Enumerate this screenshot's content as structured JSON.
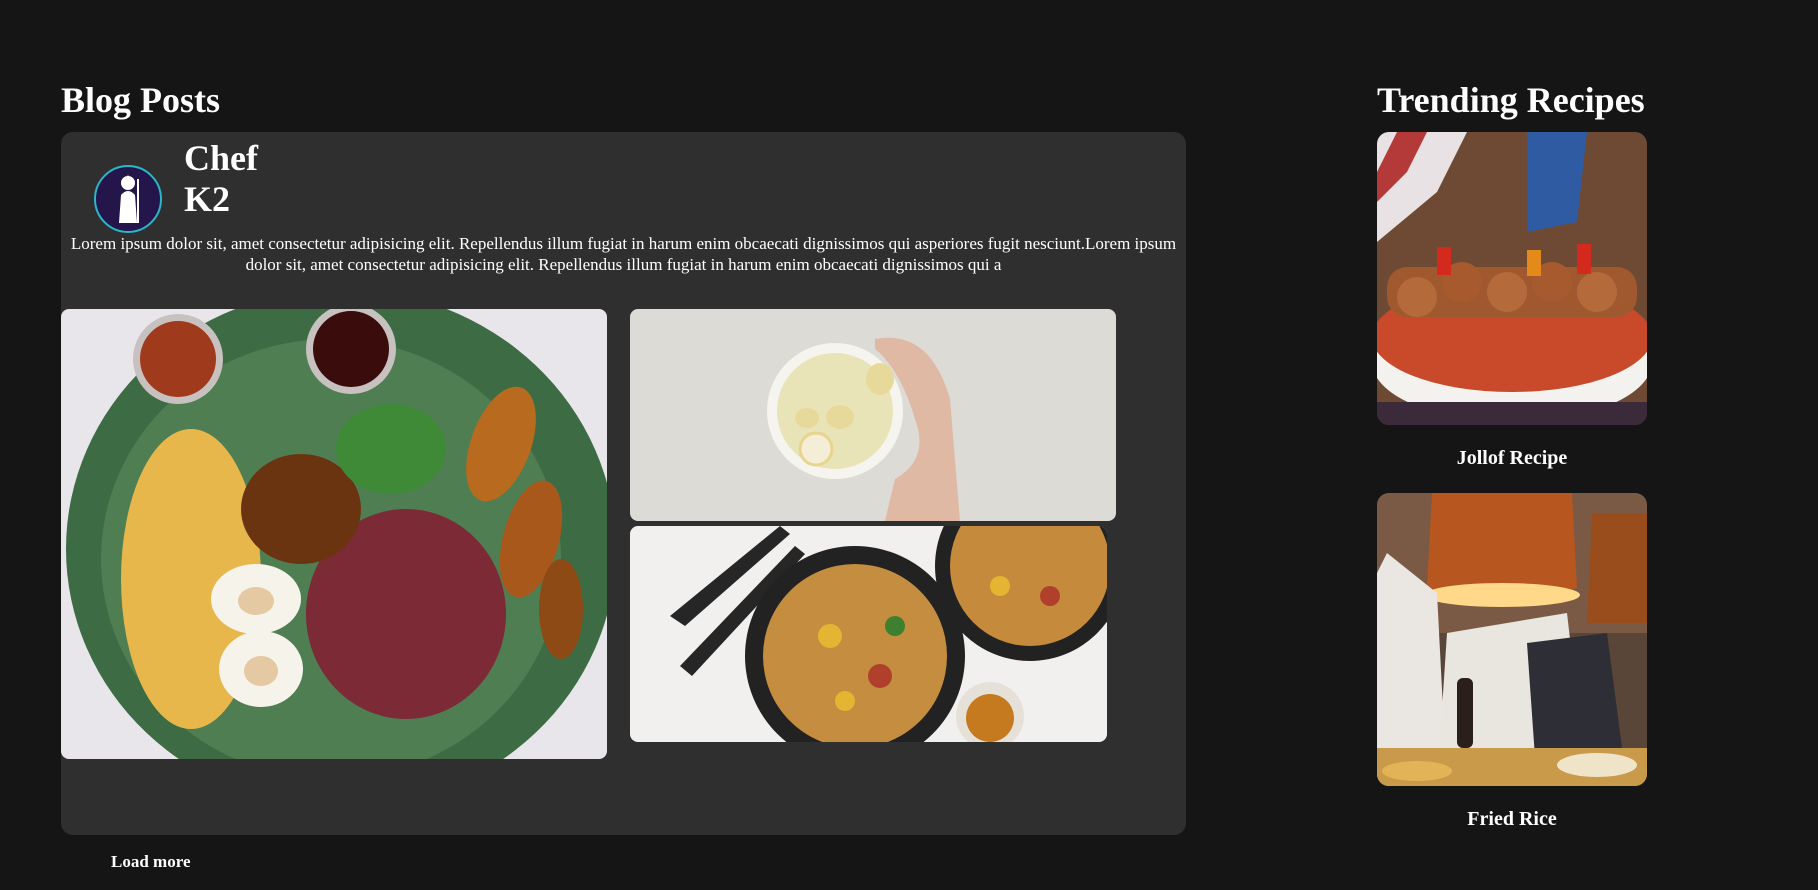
{
  "blog": {
    "heading": "Blog Posts",
    "author": "Chef K2",
    "avatar_icon": "chef-silhouette-icon",
    "text": "Lorem ipsum dolor sit, amet consectetur adipisicing elit. Repellendus illum fugiat in harum enim obcaecati dignissimos qui asperiores fugit nesciunt.Lorem ipsum dolor sit, amet consectetur adipisicing elit. Repellendus illum fugiat in harum enim obcaecati dignissimos qui a",
    "load_more": "Load more"
  },
  "trending": {
    "heading": "Trending Recipes",
    "items": [
      {
        "label": "Jollof Recipe"
      },
      {
        "label": "Fried Rice"
      }
    ]
  },
  "colors": {
    "background": "#151515",
    "card": "#2f2f2f",
    "avatar_bg": "#24164a",
    "avatar_ring": "#29b7c9"
  }
}
